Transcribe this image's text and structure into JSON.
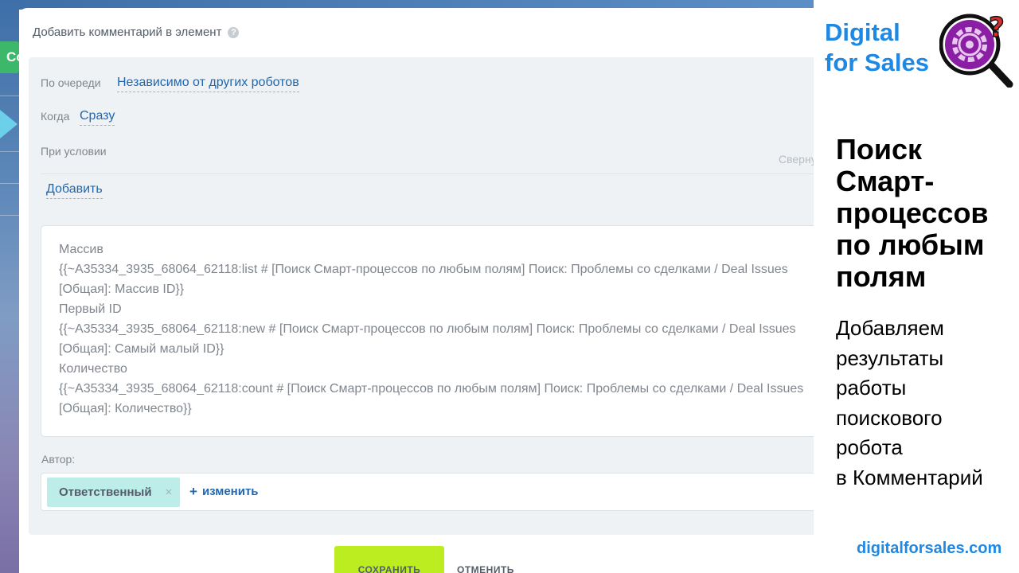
{
  "background_app": {
    "green_button_text": "Со"
  },
  "dialog": {
    "title": "Добавить комментарий в элемент",
    "help_icon": "question-icon",
    "queue": {
      "label": "По очереди",
      "value": "Независимо от других роботов"
    },
    "when": {
      "label": "Когда",
      "value": "Сразу"
    },
    "condition": {
      "label": "При условии",
      "collapse_text": "Свернуть",
      "add_link": "Добавить"
    },
    "comment_lines": [
      "Массив",
      "{{~A35334_3935_68064_62118:list # [Поиск Смарт-процессов по любым полям] Поиск: Проблемы со сделками / Deal Issues [Общая]: Массив ID}}",
      "Первый ID",
      "{{~A35334_3935_68064_62118:new # [Поиск Смарт-процессов по любым полям] Поиск: Проблемы со сделками / Deal Issues [Общая]: Самый малый ID}}",
      "Количество",
      "{{~A35334_3935_68064_62118:count # [Поиск Смарт-процессов по любым полям] Поиск: Проблемы со сделками / Deal Issues [Общая]: Количество}}"
    ],
    "author": {
      "label": "Автор:",
      "tag": "Ответственный",
      "tag_close": "×",
      "change_plus": "+",
      "change_link": "изменить"
    },
    "buttons": {
      "save": "СОХРАНИТЬ",
      "cancel": "ОТМЕНИТЬ"
    }
  },
  "branding": {
    "name_line1": "Digital",
    "name_line2": "for Sales",
    "logo_icon": "gear-magnifier-question-icon",
    "headline_lines": [
      "Поиск",
      "Смарт-",
      "процессов",
      "по любым",
      "полям"
    ],
    "subtitle_lines": [
      "Добавляем",
      "результаты",
      "работы",
      "поискового",
      "робота",
      "в Комментарий"
    ],
    "website": "digitalforsales.com",
    "colors": {
      "brand_blue": "#1e88e5",
      "logo_purple": "#8a1fa3",
      "logo_red": "#d32f2f"
    }
  }
}
